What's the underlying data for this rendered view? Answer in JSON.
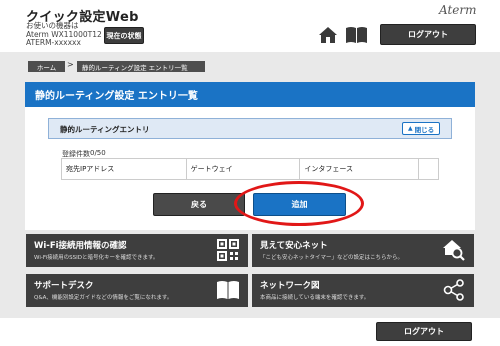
{
  "header": {
    "app_title": "クイック設定Web",
    "device_label": "お使いの機器は",
    "device_model": "Aterm WX11000T12",
    "device_id": "ATERM-xxxxxx",
    "status_button": "現在の状態",
    "brand": "Aterm",
    "logout": "ログアウト",
    "icons": [
      "home-icon",
      "manual-book-icon"
    ]
  },
  "breadcrumb": {
    "home": "ホーム",
    "separator": ">",
    "current": "静的ルーティング設定 エントリ一覧"
  },
  "page": {
    "title": "静的ルーティング設定 エントリ一覧",
    "section_title": "静的ルーティングエントリ",
    "close_button": "閉じる",
    "count_label": "登録件数",
    "count_value": "0/50",
    "table_headers": [
      "宛先IPアドレス",
      "ゲートウェイ",
      "インタフェース",
      ""
    ],
    "back_button": "戻る",
    "add_button": "追加",
    "highlight_color": "#e11717",
    "accent_color": "#1a73c5"
  },
  "tiles": [
    {
      "title": "Wi-Fi接続用情報の確認",
      "desc": "Wi-Fi接続用のSSIDと暗号化キーを確認できます。",
      "icon": "qr-code-icon"
    },
    {
      "title": "見えて安心ネット",
      "desc": "「こども安心ネットタイマー」などの設定はこちらから。",
      "icon": "home-search-icon"
    },
    {
      "title": "サポートデスク",
      "desc": "Q&A、機能別設定ガイドなどの情報をご覧になれます。",
      "icon": "book-icon"
    },
    {
      "title": "ネットワーク図",
      "desc": "本商品に接続している端末を確認できます。",
      "icon": "network-icon"
    }
  ],
  "footer": {
    "logout": "ログアウト"
  }
}
